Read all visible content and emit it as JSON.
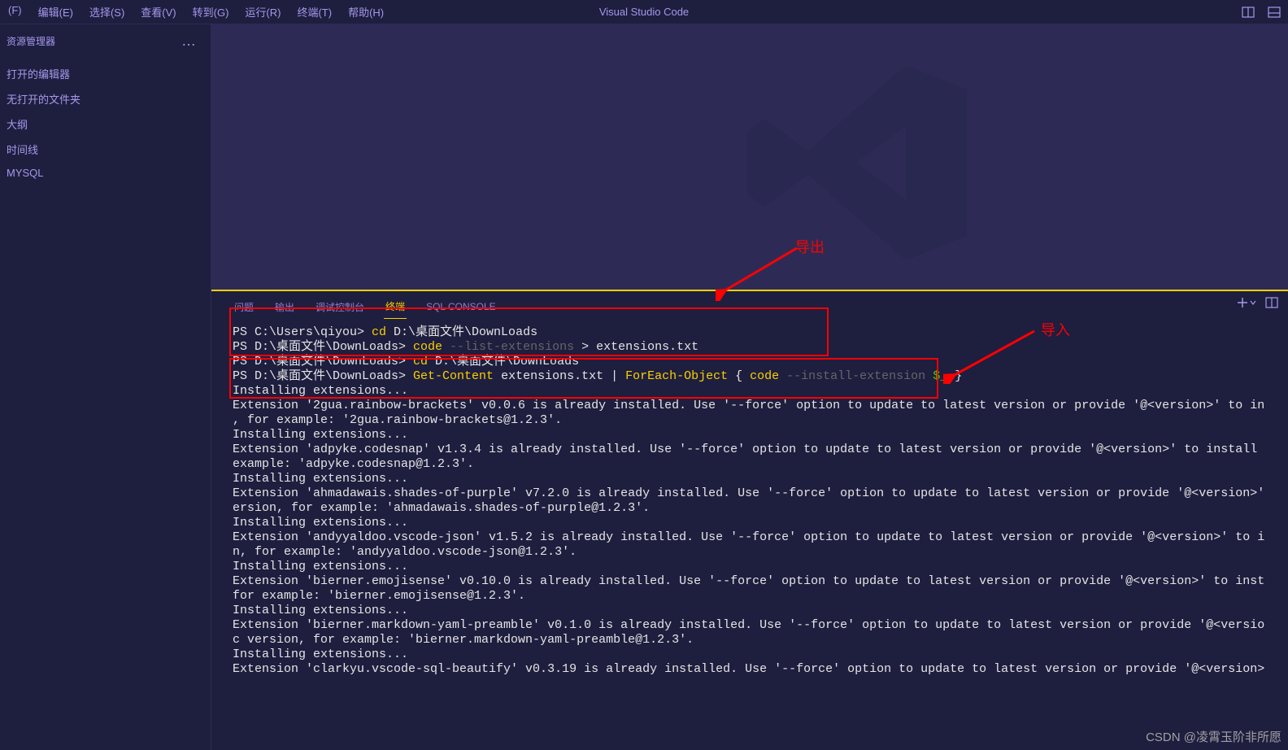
{
  "app_title": "Visual Studio Code",
  "menu": {
    "file": "(F)",
    "edit": "编辑(E)",
    "select": "选择(S)",
    "view": "查看(V)",
    "go": "转到(G)",
    "run": "运行(R)",
    "terminal": "终端(T)",
    "help": "帮助(H)"
  },
  "sidebar": {
    "title": "资源管理器",
    "sections": {
      "open_editors": "打开的编辑器",
      "no_folder": "无打开的文件夹",
      "outline": "大纲",
      "timeline": "时间线",
      "mysql": "MYSQL"
    }
  },
  "panel_tabs": {
    "problems": "问题",
    "output": "输出",
    "debug": "调试控制台",
    "terminal": "终端",
    "sql_console": "SQL CONSOLE"
  },
  "annotations": {
    "export": "导出",
    "import": "导入"
  },
  "terminal": {
    "lines": [
      {
        "type": "cmd",
        "prompt": "PS C:\\Users\\qiyou> ",
        "cmd": "cd",
        "args": " D:\\桌面文件\\DownLoads"
      },
      {
        "type": "cmd",
        "prompt": "PS D:\\桌面文件\\DownLoads> ",
        "cmd": "code",
        "gray": " --list-extensions",
        "rest": " > extensions.txt"
      },
      {
        "type": "cmd",
        "prompt": "PS D:\\桌面文件\\DownLoads> ",
        "cmd": "cd",
        "args": " D:\\桌面文件\\DownLoads"
      },
      {
        "type": "getcontent",
        "prompt": "PS D:\\桌面文件\\DownLoads> ",
        "cmd1": "Get-Content",
        "mid1": " extensions.txt | ",
        "cmd2": "ForEach-Object",
        "mid2": " { ",
        "cmd3": "code",
        "gray": " --install-extension",
        "dollar": " $_",
        "end": " }"
      },
      {
        "type": "plain",
        "text": "Installing extensions..."
      },
      {
        "type": "plain",
        "text": "Extension '2gua.rainbow-brackets' v0.0.6 is already installed. Use '--force' option to update to latest version or provide '@<version>' to in"
      },
      {
        "type": "plain",
        "text": ", for example: '2gua.rainbow-brackets@1.2.3'."
      },
      {
        "type": "plain",
        "text": "Installing extensions..."
      },
      {
        "type": "plain",
        "text": "Extension 'adpyke.codesnap' v1.3.4 is already installed. Use '--force' option to update to latest version or provide '@<version>' to install "
      },
      {
        "type": "plain",
        "text": "example: 'adpyke.codesnap@1.2.3'."
      },
      {
        "type": "plain",
        "text": "Installing extensions..."
      },
      {
        "type": "plain",
        "text": "Extension 'ahmadawais.shades-of-purple' v7.2.0 is already installed. Use '--force' option to update to latest version or provide '@<version>'"
      },
      {
        "type": "plain",
        "text": "ersion, for example: 'ahmadawais.shades-of-purple@1.2.3'."
      },
      {
        "type": "plain",
        "text": "Installing extensions..."
      },
      {
        "type": "plain",
        "text": "Extension 'andyyaldoo.vscode-json' v1.5.2 is already installed. Use '--force' option to update to latest version or provide '@<version>' to i"
      },
      {
        "type": "plain",
        "text": "n, for example: 'andyyaldoo.vscode-json@1.2.3'."
      },
      {
        "type": "plain",
        "text": "Installing extensions..."
      },
      {
        "type": "plain",
        "text": "Extension 'bierner.emojisense' v0.10.0 is already installed. Use '--force' option to update to latest version or provide '@<version>' to inst"
      },
      {
        "type": "plain",
        "text": "for example: 'bierner.emojisense@1.2.3'."
      },
      {
        "type": "plain",
        "text": "Installing extensions..."
      },
      {
        "type": "plain",
        "text": "Extension 'bierner.markdown-yaml-preamble' v0.1.0 is already installed. Use '--force' option to update to latest version or provide '@<versio"
      },
      {
        "type": "plain",
        "text": "c version, for example: 'bierner.markdown-yaml-preamble@1.2.3'."
      },
      {
        "type": "plain",
        "text": "Installing extensions..."
      },
      {
        "type": "plain",
        "text": "Extension 'clarkyu.vscode-sql-beautify' v0.3.19 is already installed. Use '--force' option to update to latest version or provide '@<version>"
      }
    ]
  },
  "watermark": "CSDN @凌霄玉阶非所愿"
}
